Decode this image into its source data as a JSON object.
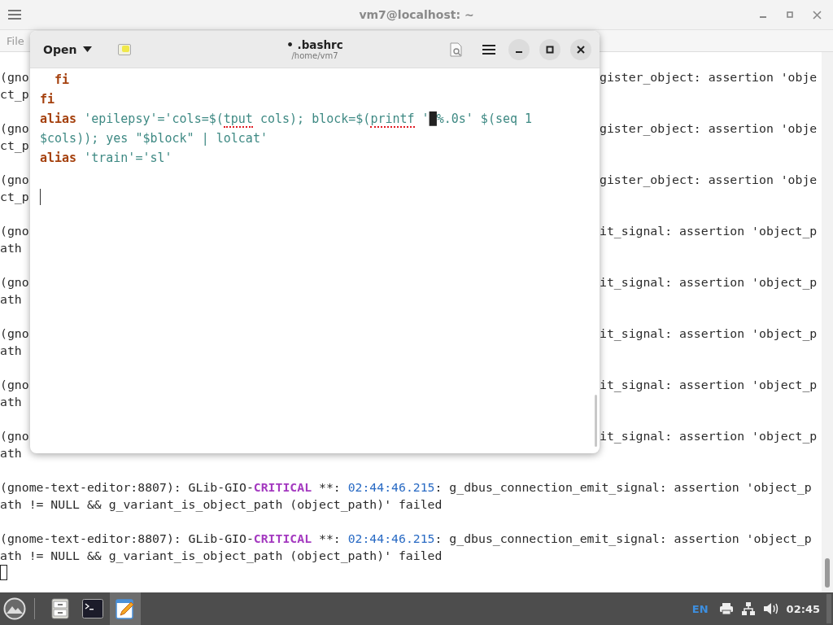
{
  "terminal": {
    "title": "vm7@localhost: ~",
    "menu": [
      "File"
    ],
    "messages": [
      {
        "lines": [
          {
            "kind": "split",
            "left": "(gno",
            "right": "gister_object: assertion 'obje"
          },
          {
            "kind": "split",
            "left": "ct_p"
          }
        ]
      },
      {
        "lines": [
          {
            "kind": "split",
            "left": "(gno",
            "right": "gister_object: assertion 'obje"
          },
          {
            "kind": "split",
            "left": "ct_p"
          }
        ]
      },
      {
        "lines": [
          {
            "kind": "split",
            "left": "(gno",
            "right": "gister_object: assertion 'obje"
          },
          {
            "kind": "split",
            "left": "ct_p"
          }
        ]
      },
      {
        "lines": [
          {
            "kind": "split",
            "left": "(gno",
            "right": "it_signal: assertion 'object_p"
          },
          {
            "kind": "split",
            "left": "ath"
          }
        ]
      },
      {
        "lines": [
          {
            "kind": "split",
            "left": "(gno",
            "right": "it_signal: assertion 'object_p"
          },
          {
            "kind": "split",
            "left": "ath"
          }
        ]
      },
      {
        "lines": [
          {
            "kind": "split",
            "left": "(gno",
            "right": "it_signal: assertion 'object_p"
          },
          {
            "kind": "split",
            "left": "ath"
          }
        ]
      },
      {
        "lines": [
          {
            "kind": "split",
            "left": "(gno",
            "right": "it_signal: assertion 'object_p"
          },
          {
            "kind": "split",
            "left": "ath"
          }
        ]
      },
      {
        "lines": [
          {
            "kind": "split",
            "left": "(gno",
            "right": "it_signal: assertion 'object_p"
          },
          {
            "kind": "split",
            "left": "ath"
          }
        ]
      },
      {
        "lines": [
          {
            "kind": "full",
            "tokens": [
              {
                "text": "(gnome-text-editor:8807): GLib-GIO-",
                "kind": "plain"
              },
              {
                "text": "CRITICAL",
                "kind": "critical"
              },
              {
                "text": " **: ",
                "kind": "plain"
              },
              {
                "text": "02:44:46.215",
                "kind": "time"
              },
              {
                "text": ": g_dbus_connection_emit_signal: assertion 'object_p",
                "kind": "plain"
              }
            ]
          },
          {
            "kind": "full",
            "tokens": [
              {
                "text": "ath != NULL && g_variant_is_object_path (object_path)' failed",
                "kind": "plain"
              }
            ]
          }
        ]
      },
      {
        "lines": [
          {
            "kind": "full",
            "tokens": [
              {
                "text": "(gnome-text-editor:8807): GLib-GIO-",
                "kind": "plain"
              },
              {
                "text": "CRITICAL",
                "kind": "critical"
              },
              {
                "text": " **: ",
                "kind": "plain"
              },
              {
                "text": "02:44:46.215",
                "kind": "time"
              },
              {
                "text": ": g_dbus_connection_emit_signal: assertion 'object_p",
                "kind": "plain"
              }
            ]
          },
          {
            "kind": "full",
            "tokens": [
              {
                "text": "ath != NULL && g_variant_is_object_path (object_path)' failed",
                "kind": "plain"
              }
            ]
          }
        ]
      }
    ]
  },
  "editor": {
    "open_label": "Open",
    "title": "• .bashrc",
    "subtitle": "/home/vm7",
    "lines": [
      {
        "tokens": [
          {
            "text": "  fi",
            "kind": "keyword",
            "misspelled": false
          }
        ]
      },
      {
        "tokens": [
          {
            "text": "fi",
            "kind": "keyword",
            "misspelled": false
          }
        ]
      },
      {
        "tokens": [
          {
            "text": "alias",
            "kind": "keyword",
            "misspelled": false
          },
          {
            "text": " 'epilepsy'='cols=$(",
            "kind": "string",
            "misspelled": false
          },
          {
            "text": "tput",
            "kind": "string",
            "misspelled": true
          },
          {
            "text": " cols); block=$(",
            "kind": "string",
            "misspelled": false
          },
          {
            "text": "printf",
            "kind": "string",
            "misspelled": true
          },
          {
            "text": " '",
            "kind": "string",
            "misspelled": false
          },
          {
            "text": "█",
            "kind": "glyph",
            "misspelled": false
          },
          {
            "text": "%.0s' $(seq 1",
            "kind": "string",
            "misspelled": false
          }
        ]
      },
      {
        "tokens": [
          {
            "text": "$cols)); yes \"$block\" | lolcat'",
            "kind": "string",
            "misspelled": false
          }
        ]
      },
      {
        "tokens": [
          {
            "text": "alias",
            "kind": "keyword",
            "misspelled": false
          },
          {
            "text": " 'train'='sl'",
            "kind": "string",
            "misspelled": false
          }
        ]
      }
    ]
  },
  "taskbar": {
    "tasks": [
      {
        "kind": "files",
        "selected": false
      },
      {
        "kind": "terminal",
        "selected": false
      },
      {
        "kind": "editor",
        "selected": true
      }
    ],
    "language": "EN",
    "clock": "02:45"
  }
}
